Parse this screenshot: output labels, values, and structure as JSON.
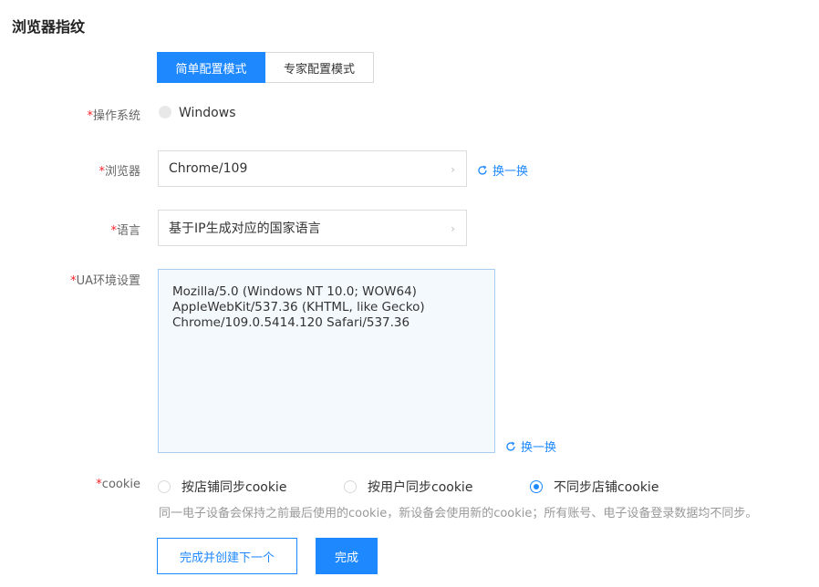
{
  "page": {
    "title": "浏览器指纹"
  },
  "mode_tabs": [
    {
      "label": "简单配置模式",
      "active": true
    },
    {
      "label": "专家配置模式",
      "active": false
    }
  ],
  "required_mark": "*",
  "os": {
    "label": "操作系统",
    "option": "Windows"
  },
  "browser": {
    "label": "浏览器",
    "value": "Chrome/109",
    "swap_label": "换一换"
  },
  "language": {
    "label": "语言",
    "value": "基于IP生成对应的国家语言"
  },
  "ua": {
    "label": "UA环境设置",
    "value": "Mozilla/5.0 (Windows NT 10.0; WOW64)\nAppleWebKit/537.36 (KHTML, like Gecko)\nChrome/109.0.5414.120 Safari/537.36",
    "swap_label": "换一换"
  },
  "cookie": {
    "label": "cookie",
    "options": [
      "按店铺同步cookie",
      "按用户同步cookie",
      "不同步店铺cookie"
    ],
    "selected": "不同步店铺cookie",
    "hint": "同一电子设备会保持之前最后使用的cookie，新设备会使用新的cookie；所有账号、电子设备登录数据均不同步。"
  },
  "actions": {
    "secondary": "完成并创建下一个",
    "primary": "完成"
  },
  "colors": {
    "accent": "#1e88ff",
    "required": "#f5222d",
    "ua_bg": "#f4f9fe"
  }
}
